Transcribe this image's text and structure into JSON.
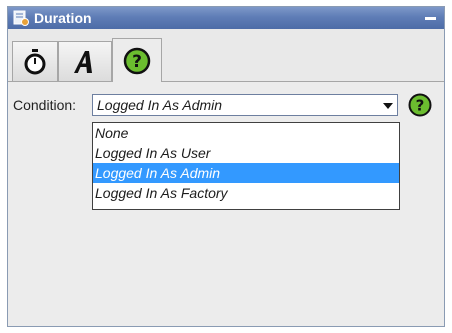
{
  "window": {
    "title": "Duration"
  },
  "tabs": [
    {
      "icon": "stopwatch-icon"
    },
    {
      "icon": "script-a-icon"
    },
    {
      "icon": "help-icon",
      "active": true
    }
  ],
  "condition": {
    "label": "Condition:",
    "selected": "Logged In As Admin",
    "options": [
      "None",
      "Logged In As User",
      "Logged In As Admin",
      "Logged In As Factory"
    ]
  },
  "colors": {
    "titlebar": "#5f7db6",
    "selection": "#3399ff",
    "help_green": "#5aa82c"
  }
}
